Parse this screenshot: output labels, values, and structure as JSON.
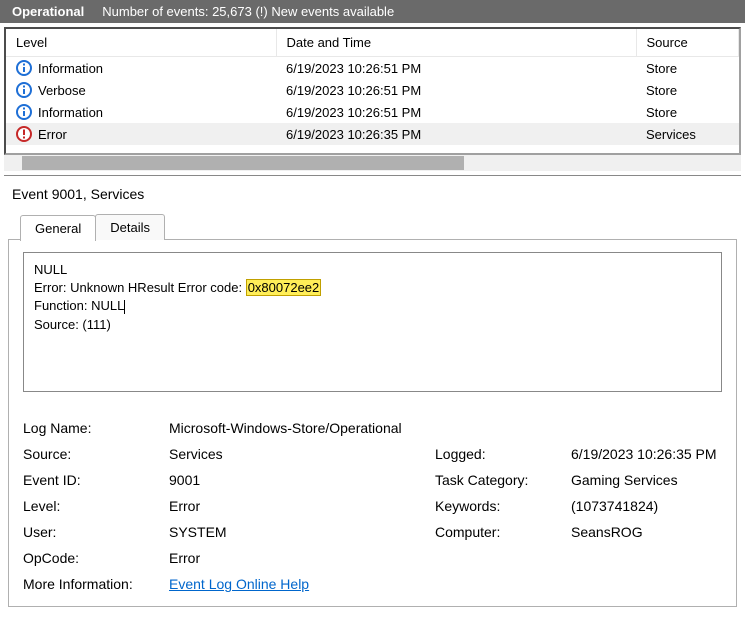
{
  "header": {
    "title": "Operational",
    "status": "Number of events: 25,673 (!) New events available"
  },
  "columns": {
    "level": "Level",
    "datetime": "Date and Time",
    "source": "Source"
  },
  "rows": [
    {
      "icon": "info",
      "level": "Information",
      "datetime": "6/19/2023 10:26:51 PM",
      "source": "Store"
    },
    {
      "icon": "info",
      "level": "Verbose",
      "datetime": "6/19/2023 10:26:51 PM",
      "source": "Store"
    },
    {
      "icon": "info",
      "level": "Information",
      "datetime": "6/19/2023 10:26:51 PM",
      "source": "Store"
    },
    {
      "icon": "error",
      "level": "Error",
      "datetime": "6/19/2023 10:26:35 PM",
      "source": "Services"
    }
  ],
  "event": {
    "title": "Event 9001, Services",
    "tabs": {
      "general": "General",
      "details": "Details"
    },
    "msg": {
      "l1": "NULL",
      "l2a": "Error: Unknown HResult Error code: ",
      "l2b": "0x80072ee2",
      "l3": "Function: NULL",
      "l4": "Source:  (111)"
    },
    "props": {
      "log_name_k": "Log Name:",
      "log_name_v": "Microsoft-Windows-Store/Operational",
      "source_k": "Source:",
      "source_v": "Services",
      "logged_k": "Logged:",
      "logged_v": "6/19/2023 10:26:35 PM",
      "event_id_k": "Event ID:",
      "event_id_v": "9001",
      "task_cat_k": "Task Category:",
      "task_cat_v": "Gaming Services",
      "level_k": "Level:",
      "level_v": "Error",
      "keywords_k": "Keywords:",
      "keywords_v": "(1073741824)",
      "user_k": "User:",
      "user_v": "SYSTEM",
      "computer_k": "Computer:",
      "computer_v": "SeansROG",
      "opcode_k": "OpCode:",
      "opcode_v": "Error",
      "more_info_k": "More Information:",
      "more_info_link": "Event Log Online Help"
    }
  }
}
